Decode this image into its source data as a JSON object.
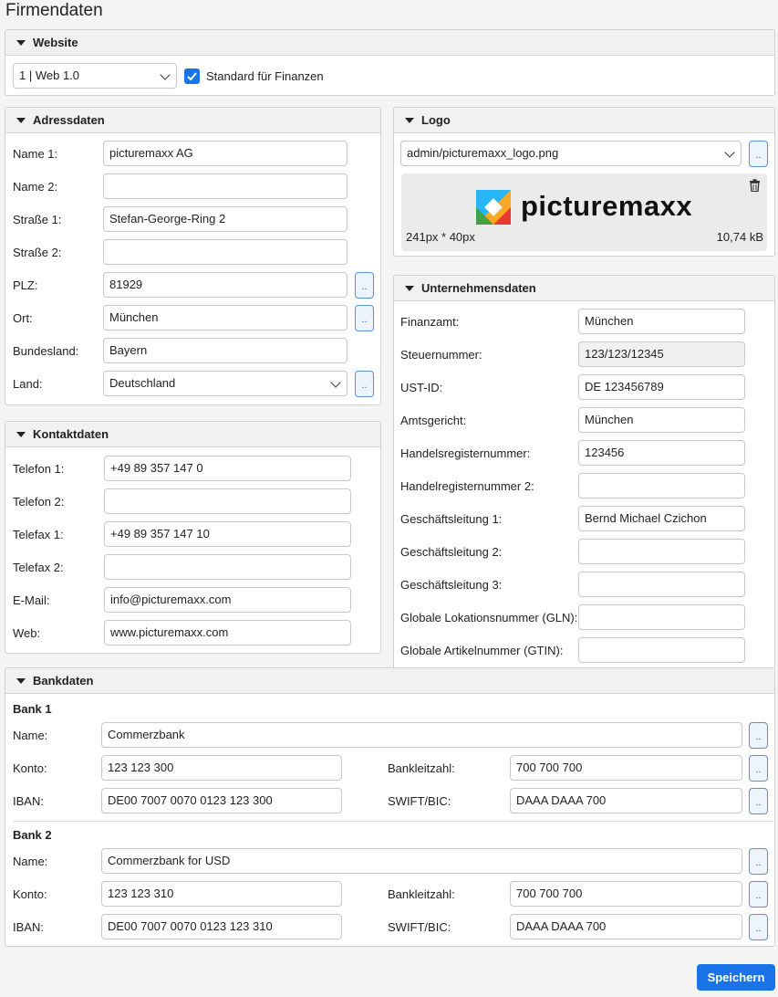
{
  "page_title": "Firmendaten",
  "website": {
    "header": "Website",
    "select_value": "1 | Web 1.0",
    "checkbox_label": "Standard für Finanzen",
    "checkbox_checked": true
  },
  "adressdaten": {
    "header": "Adressdaten",
    "fields": [
      {
        "label": "Name 1:",
        "value": "picturemaxx AG"
      },
      {
        "label": "Name 2:",
        "value": ""
      },
      {
        "label": "Straße 1:",
        "value": "Stefan-George-Ring 2"
      },
      {
        "label": "Straße 2:",
        "value": ""
      },
      {
        "label": "PLZ:",
        "value": "81929"
      },
      {
        "label": "Ort:",
        "value": "München"
      },
      {
        "label": "Bundesland:",
        "value": "Bayern"
      },
      {
        "label": "Land:",
        "value": "Deutschland"
      }
    ],
    "dots": ".."
  },
  "logo": {
    "header": "Logo",
    "select_value": "admin/picturemaxx_logo.png",
    "dots": "..",
    "logo_text": "picturemaxx",
    "dimensions": "241px * 40px",
    "filesize": "10,74 kB"
  },
  "kontaktdaten": {
    "header": "Kontaktdaten",
    "fields": [
      {
        "label": "Telefon 1:",
        "value": "+49 89 357 147 0"
      },
      {
        "label": "Telefon 2:",
        "value": ""
      },
      {
        "label": "Telefax 1:",
        "value": "+49 89 357 147 10"
      },
      {
        "label": "Telefax 2:",
        "value": ""
      },
      {
        "label": "E-Mail:",
        "value": "info@picturemaxx.com"
      },
      {
        "label": "Web:",
        "value": "www.picturemaxx.com"
      }
    ]
  },
  "unternehmensdaten": {
    "header": "Unternehmensdaten",
    "fields": [
      {
        "label": "Finanzamt:",
        "value": "München"
      },
      {
        "label": "Steuernummer:",
        "value": "123/123/12345"
      },
      {
        "label": "UST-ID:",
        "value": "DE 123456789"
      },
      {
        "label": "Amtsgericht:",
        "value": "München"
      },
      {
        "label": "Handelsregisternummer:",
        "value": "123456"
      },
      {
        "label": "Handelregisternummer 2:",
        "value": ""
      },
      {
        "label": "Geschäftsleitung 1:",
        "value": "Bernd Michael Czichon"
      },
      {
        "label": "Geschäftsleitung 2:",
        "value": ""
      },
      {
        "label": "Geschäftsleitung 3:",
        "value": ""
      },
      {
        "label": "Globale Lokationsnummer (GLN):",
        "value": ""
      },
      {
        "label": "Globale Artikelnummer (GTIN):",
        "value": ""
      }
    ]
  },
  "bankdaten": {
    "header": "Bankdaten",
    "labels": {
      "name": "Name:",
      "konto": "Konto:",
      "iban": "IBAN:",
      "blz": "Bankleitzahl:",
      "swift": "SWIFT/BIC:"
    },
    "dots": "..",
    "banks": [
      {
        "title": "Bank 1",
        "name": "Commerzbank",
        "konto": "123 123 300",
        "iban": "DE00 7007 0070 0123 123 300",
        "blz": "700 700 700",
        "swift": "DAAA DAAA 700"
      },
      {
        "title": "Bank 2",
        "name": "Commerzbank for USD",
        "konto": "123 123 310",
        "iban": "DE00 7007 0070 0123 123 310",
        "blz": "700 700 700",
        "swift": "DAAA DAAA 700"
      }
    ]
  },
  "save_label": "Speichern",
  "colors": {
    "accent": "#1a73e8"
  }
}
